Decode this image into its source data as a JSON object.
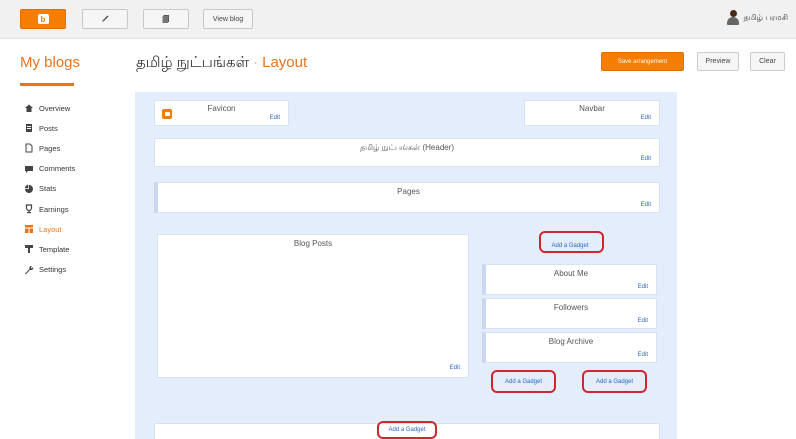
{
  "topbar": {
    "blogger_icon": "blogger-b-icon",
    "pencil_icon": "pencil-icon",
    "posts_icon": "document-icon",
    "view_blog": "View blog",
    "user_name": "தமிழ் பரமசி"
  },
  "header": {
    "my_blogs": "My blogs",
    "blog_title": "தமிழ் நுட்பங்கள்",
    "separator": "·",
    "section": "Layout",
    "save_arrangement": "Save arrangement",
    "preview": "Preview",
    "clear": "Clear"
  },
  "sidebar": {
    "items": [
      {
        "label": "Overview",
        "icon": "home-icon",
        "active": false
      },
      {
        "label": "Posts",
        "icon": "posts-icon",
        "active": false
      },
      {
        "label": "Pages",
        "icon": "pages-icon",
        "active": false
      },
      {
        "label": "Comments",
        "icon": "comments-icon",
        "active": false
      },
      {
        "label": "Stats",
        "icon": "stats-icon",
        "active": false
      },
      {
        "label": "Earnings",
        "icon": "trophy-icon",
        "active": false
      },
      {
        "label": "Layout",
        "icon": "layout-icon",
        "active": true
      },
      {
        "label": "Template",
        "icon": "template-icon",
        "active": false
      },
      {
        "label": "Settings",
        "icon": "wrench-icon",
        "active": false
      }
    ]
  },
  "layout": {
    "favicon": {
      "title": "Favicon",
      "edit": "Edit"
    },
    "navbar": {
      "title": "Navbar",
      "edit": "Edit"
    },
    "header": {
      "title": "தமிழ் நுட்பங்கள் (Header)",
      "edit": "Edit"
    },
    "pages": {
      "title": "Pages",
      "edit": "Edit"
    },
    "blog_posts": {
      "title": "Blog Posts",
      "edit": "Edit"
    },
    "sidebar_add_gadget": "Add a Gadget",
    "about_me": {
      "title": "About Me",
      "edit": "Edit"
    },
    "followers": {
      "title": "Followers",
      "edit": "Edit"
    },
    "blog_archive": {
      "title": "Blog Archive",
      "edit": "Edit"
    },
    "footer_left_add_gadget": "Add a Gadget",
    "footer_right_add_gadget": "Add a Gadget",
    "bottom_add_gadget": "Add a Gadget"
  },
  "colors": {
    "accent": "#f57d00",
    "highlight_ring": "#d0272f",
    "canvas_bg": "#e4edfb",
    "link": "#2a66c8"
  }
}
